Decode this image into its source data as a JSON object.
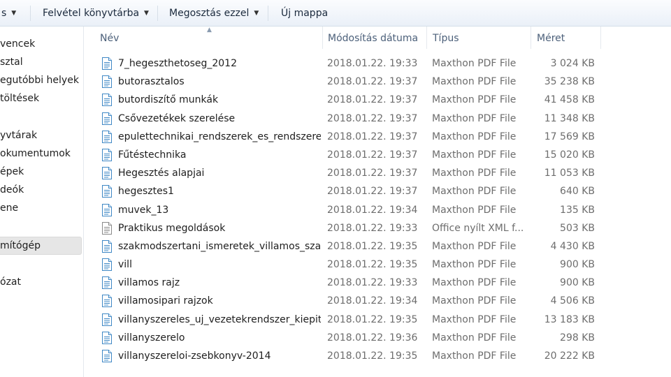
{
  "toolbar": {
    "organize_partial": "s",
    "library_label": "Felvétel könyvtárba",
    "share_label": "Megosztás ezzel",
    "new_folder_label": "Új mappa"
  },
  "sidebar": {
    "items": [
      {
        "label": "vencek"
      },
      {
        "label": "sztal"
      },
      {
        "label": "egutóbbi helyek"
      },
      {
        "label": "töltések"
      },
      {
        "label": "yvtárak"
      },
      {
        "label": "okumentumok"
      },
      {
        "label": "épek"
      },
      {
        "label": "deók"
      },
      {
        "label": "ene"
      },
      {
        "label": "mítógép"
      },
      {
        "label": "ózat"
      }
    ]
  },
  "columns": {
    "name": "Név",
    "date": "Módosítás dátuma",
    "type": "Típus",
    "size": "Méret"
  },
  "files": [
    {
      "name": "7_hegeszthetoseg_2012",
      "date": "2018.01.22. 19:33",
      "type": "Maxthon PDF File",
      "size": "3 024 KB",
      "icon": "pdf-file-icon"
    },
    {
      "name": "butorasztalos",
      "date": "2018.01.22. 19:37",
      "type": "Maxthon PDF File",
      "size": "35 238 KB",
      "icon": "pdf-file-icon"
    },
    {
      "name": "butordiszítő  munkák",
      "date": "2018.01.22. 19:37",
      "type": "Maxthon PDF File",
      "size": "41 458 KB",
      "icon": "pdf-file-icon"
    },
    {
      "name": "Csővezetékek szerelése",
      "date": "2018.01.22. 19:37",
      "type": "Maxthon PDF File",
      "size": "11 348 KB",
      "icon": "pdf-file-icon"
    },
    {
      "name": "epulettechnikai_rendszerek_es_rendszerel...",
      "date": "2018.01.22. 19:37",
      "type": "Maxthon PDF File",
      "size": "17 569 KB",
      "icon": "pdf-file-icon"
    },
    {
      "name": "Fűtéstechnika",
      "date": "2018.01.22. 19:37",
      "type": "Maxthon PDF File",
      "size": "15 020 KB",
      "icon": "pdf-file-icon"
    },
    {
      "name": "Hegesztés alapjai",
      "date": "2018.01.22. 19:37",
      "type": "Maxthon PDF File",
      "size": "11 053 KB",
      "icon": "pdf-file-icon"
    },
    {
      "name": "hegesztes1",
      "date": "2018.01.22. 19:37",
      "type": "Maxthon PDF File",
      "size": "640 KB",
      "icon": "pdf-file-icon"
    },
    {
      "name": "muvek_13",
      "date": "2018.01.22. 19:34",
      "type": "Maxthon PDF File",
      "size": "135 KB",
      "icon": "pdf-file-icon"
    },
    {
      "name": "Praktikus megoldások",
      "date": "2018.01.22. 19:33",
      "type": "Office nyílt XML f...",
      "size": "503 KB",
      "icon": "xml-document-icon"
    },
    {
      "name": "szakmodszertani_ismeretek_villamos_sza...",
      "date": "2018.01.22. 19:35",
      "type": "Maxthon PDF File",
      "size": "4 430 KB",
      "icon": "pdf-file-icon"
    },
    {
      "name": "vill",
      "date": "2018.01.22. 19:35",
      "type": "Maxthon PDF File",
      "size": "900 KB",
      "icon": "pdf-file-icon"
    },
    {
      "name": "villamos rajz",
      "date": "2018.01.22. 19:33",
      "type": "Maxthon PDF File",
      "size": "900 KB",
      "icon": "pdf-file-icon"
    },
    {
      "name": "villamosipari rajzok",
      "date": "2018.01.22. 19:34",
      "type": "Maxthon PDF File",
      "size": "4 506 KB",
      "icon": "pdf-file-icon"
    },
    {
      "name": "villanyszereles_uj_vezetekrendszer_kiepite...",
      "date": "2018.01.22. 19:35",
      "type": "Maxthon PDF File",
      "size": "13 183 KB",
      "icon": "pdf-file-icon"
    },
    {
      "name": "villanyszerelo",
      "date": "2018.01.22. 19:36",
      "type": "Maxthon PDF File",
      "size": "298 KB",
      "icon": "pdf-file-icon"
    },
    {
      "name": "villanyszereloi-zsebkonyv-2014",
      "date": "2018.01.22. 19:35",
      "type": "Maxthon PDF File",
      "size": "20 222 KB",
      "icon": "pdf-file-icon"
    }
  ]
}
